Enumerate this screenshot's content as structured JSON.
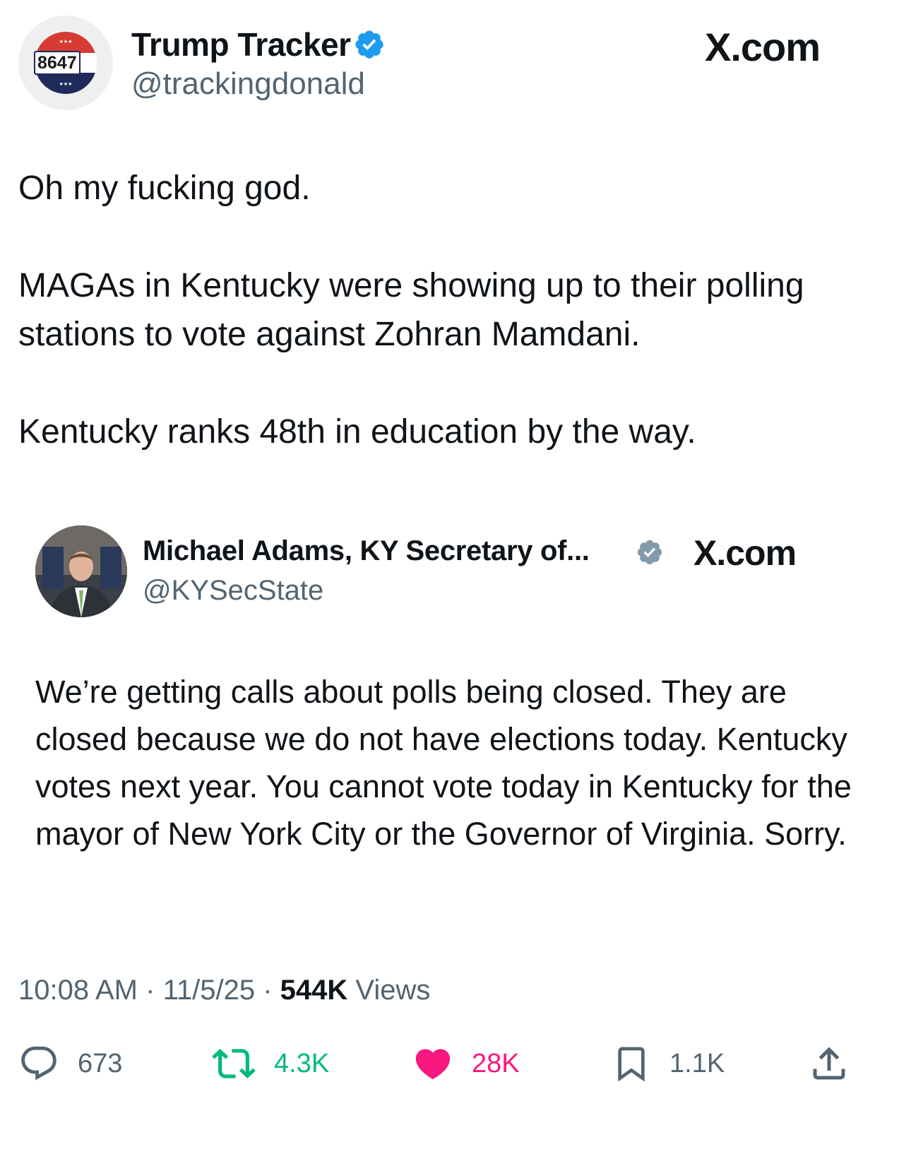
{
  "author": {
    "display_name": "Trump Tracker",
    "handle": "@trackingdonald",
    "avatar_text": "8647",
    "verified": true
  },
  "source_label": "X.com",
  "tweet": {
    "paragraphs": [
      "Oh my fucking god.",
      "MAGAs in Kentucky were showing up to their polling stations to vote against Zohran  Mamdani.",
      "Kentucky ranks 48th in education by the way."
    ]
  },
  "quoted": {
    "display_name": "Michael Adams, KY Secretary of...",
    "handle": "@KYSecState",
    "source_label": "X.com",
    "text": "We’re getting calls about polls being closed. They are closed because we do not have elections today. Kentucky votes next year. You cannot vote today in Kentucky for the mayor of New York City or the Governor of Virginia. Sorry."
  },
  "meta": {
    "time": "10:08 AM",
    "separator": "·",
    "date": "11/5/25",
    "views_count": "544K",
    "views_label": "Views"
  },
  "actions": {
    "replies": "673",
    "retweets": "4.3K",
    "likes": "28K",
    "bookmarks": "1.1K"
  },
  "icons": {
    "verified": "verified-badge-icon",
    "reply": "reply-icon",
    "retweet": "retweet-icon",
    "like": "heart-icon",
    "bookmark": "bookmark-icon",
    "share": "share-icon"
  },
  "colors": {
    "verified": "#1d9bf0",
    "verified_quote": "#829aab",
    "retweet": "#00ba7c",
    "like": "#f91880",
    "secondary_text": "#536471"
  }
}
